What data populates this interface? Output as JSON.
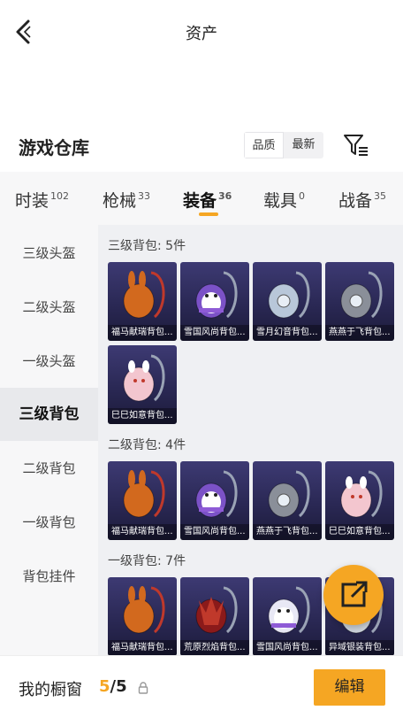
{
  "header": {
    "title": "资产"
  },
  "warehouse": {
    "title": "游戏仓库",
    "sort_options": [
      "品质",
      "最新"
    ]
  },
  "tabs": [
    {
      "label": "时装",
      "count": "102"
    },
    {
      "label": "枪械",
      "count": "33"
    },
    {
      "label": "装备",
      "count": "36"
    },
    {
      "label": "载具",
      "count": "0"
    },
    {
      "label": "战备",
      "count": "35"
    }
  ],
  "sidebar": {
    "items": [
      {
        "label": "三级头盔"
      },
      {
        "label": "二级头盔"
      },
      {
        "label": "一级头盔"
      },
      {
        "label": "三级背包"
      },
      {
        "label": "二级背包"
      },
      {
        "label": "一级背包"
      },
      {
        "label": "背包挂件"
      }
    ]
  },
  "sections": [
    {
      "title": "三级背包: 5件",
      "items": [
        {
          "name": "福马献瑞背包...",
          "icon": "bunny-backpack-icon",
          "color": "#d2691e"
        },
        {
          "name": "雪国风尚背包...",
          "icon": "penguin-backpack-icon",
          "color": "#7b52c7"
        },
        {
          "name": "雪月幻音背包...",
          "icon": "crystal-backpack-icon",
          "color": "#b8c7d9"
        },
        {
          "name": "燕燕于飞背包...",
          "icon": "swallow-backpack-icon",
          "color": "#8a8f99"
        },
        {
          "name": "巳巳如意背包...",
          "icon": "snake-backpack-icon",
          "color": "#f3c6cf"
        }
      ]
    },
    {
      "title": "二级背包: 4件",
      "items": [
        {
          "name": "福马献瑞背包...",
          "icon": "bunny-backpack-icon",
          "color": "#d2691e"
        },
        {
          "name": "雪国风尚背包...",
          "icon": "penguin-backpack-icon",
          "color": "#7b52c7"
        },
        {
          "name": "燕燕于飞背包...",
          "icon": "swallow-backpack-icon",
          "color": "#8a8f99"
        },
        {
          "name": "巳巳如意背包...",
          "icon": "snake-backpack-icon",
          "color": "#f3c6cf"
        }
      ]
    },
    {
      "title": "一级背包: 7件",
      "items": [
        {
          "name": "福马献瑞背包...",
          "icon": "bunny-backpack-icon",
          "color": "#d2691e"
        },
        {
          "name": "荒原烈焰背包...",
          "icon": "flame-backpack-icon",
          "color": "#8b1a1a"
        },
        {
          "name": "雪国风尚背包...",
          "icon": "snowman-backpack-icon",
          "color": "#e8e8f5"
        },
        {
          "name": "异域银装背包...",
          "icon": "silver-backpack-icon",
          "color": "#cfd6de"
        }
      ]
    }
  ],
  "showcase": {
    "label": "我的橱窗",
    "current": "5",
    "sep": "/",
    "total": "5"
  },
  "edit_label": "编辑",
  "colors": {
    "accent": "#f5a623"
  }
}
